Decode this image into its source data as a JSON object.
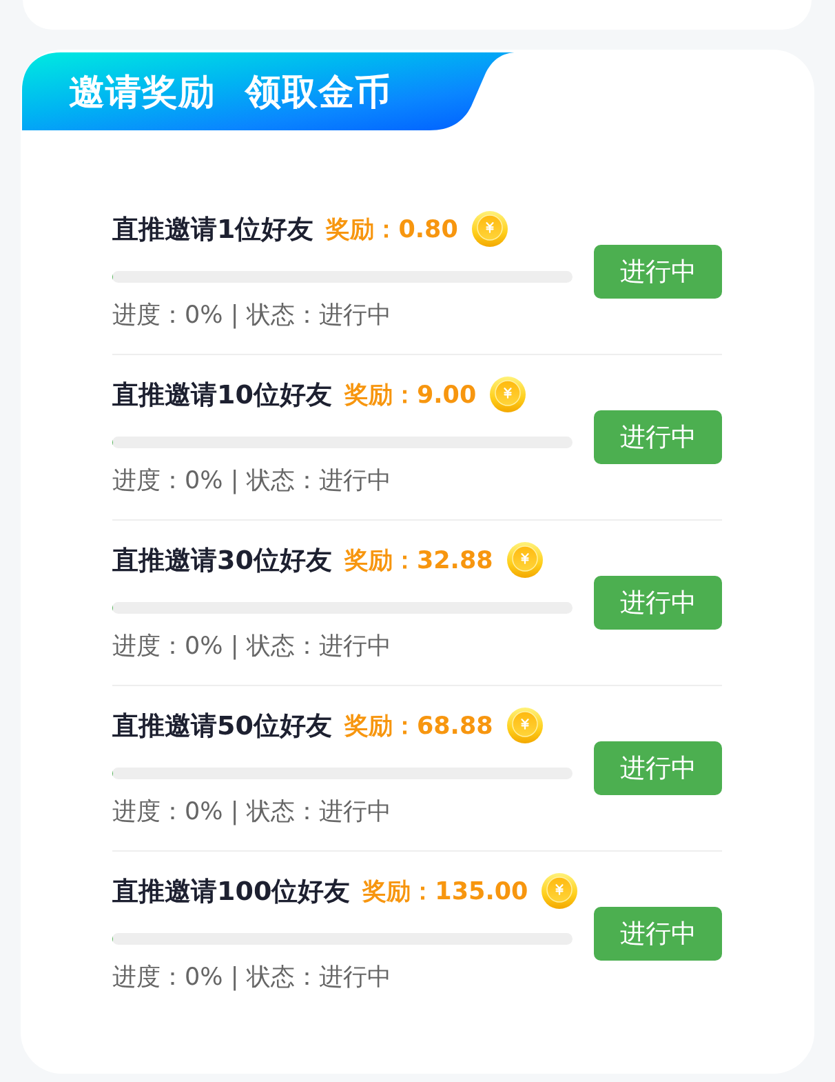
{
  "banner": {
    "title": "邀请奖励",
    "subtitle": "领取金币"
  },
  "tasks": [
    {
      "title": "直推邀请1位好友",
      "reward": "奖励：0.80",
      "level": 0,
      "progress_text": "进度：0% | 状态：进行中",
      "button": "进行中"
    },
    {
      "title": "直推邀请10位好友",
      "reward": "奖励：9.00",
      "level": 0,
      "progress_text": "进度：0% | 状态：进行中",
      "button": "进行中"
    },
    {
      "title": "直推邀请30位好友",
      "reward": "奖励：32.88",
      "level": 0,
      "progress_text": "进度：0% | 状态：进行中",
      "button": "进行中"
    },
    {
      "title": "直推邀请50位好友",
      "reward": "奖励：68.88",
      "level": 0,
      "progress_text": "进度：0% | 状态：进行中",
      "button": "进行中"
    },
    {
      "title": "直推邀请100位好友",
      "reward": "奖励：135.00",
      "level": 0,
      "progress_text": "进度：0% | 状态：进行中",
      "button": "进行中"
    }
  ]
}
